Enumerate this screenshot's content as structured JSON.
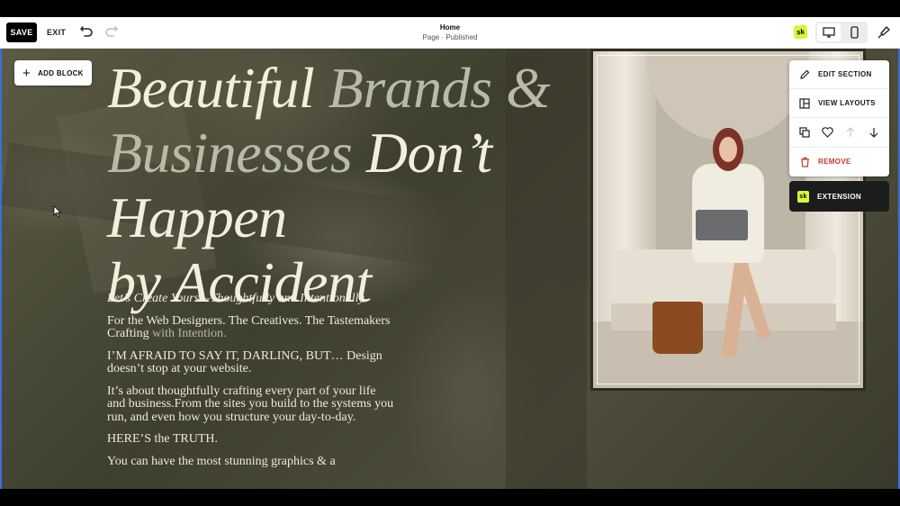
{
  "topbar": {
    "save_label": "SAVE",
    "exit_label": "EXIT",
    "page_title": "Home",
    "page_status": "Page · Published",
    "sk_badge": "sk"
  },
  "canvas": {
    "add_block_label": "ADD BLOCK",
    "headline": {
      "line1_a": "Beautiful",
      "line1_b": "Brands &",
      "line2_a": "Businesses",
      "line2_b": "Don’t Happen",
      "line3": "by Accident"
    },
    "body": {
      "intro": "Let’s Create Yours—Thoughtfully and Intentionally.",
      "p1_a": "For the Web Designers. The Creatives. The Tastemakers Crafting",
      "p1_b": "with Intention.",
      "p2": "I’M AFRAID TO SAY IT, DARLING, BUT… Design doesn’t stop at your website.",
      "p3": "It’s about thoughtfully crafting every part of your life and business.From the sites you build to the systems you run, and even how you structure your day-to-day.",
      "p4": "HERE’S the TRUTH.",
      "p5": "You can have the most stunning graphics & a"
    }
  },
  "section_toolbar": {
    "edit_section": "EDIT SECTION",
    "view_layouts": "VIEW LAYOUTS",
    "remove": "REMOVE",
    "extension": "EXTENSION",
    "extension_badge": "sk"
  },
  "colors": {
    "accent_blue": "#3d6fd8",
    "remove_red": "#c7392b",
    "sk_yellow": "#d8f53a"
  }
}
